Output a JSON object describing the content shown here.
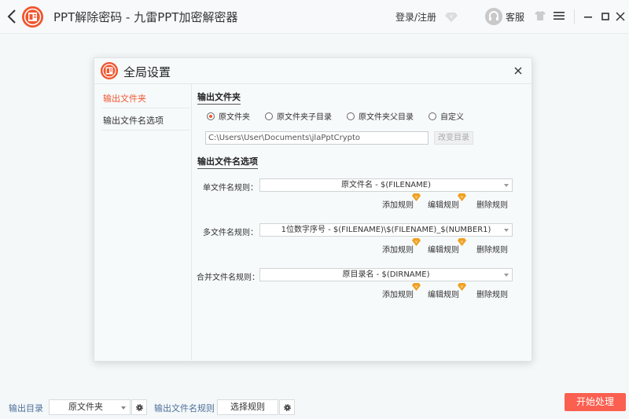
{
  "titlebar": {
    "title": "PPT解除密码 - 九雷PPT加密解密器",
    "login_label": "登录/注册",
    "service_label": "客服",
    "icons": [
      "back-icon",
      "app-logo-icon",
      "vip-icon",
      "headset-icon",
      "skin-icon",
      "menu-icon",
      "minimize-icon",
      "maximize-icon",
      "close-icon"
    ]
  },
  "dialog": {
    "title": "全局设置",
    "sidebar": [
      {
        "label": "输出文件夹",
        "active": true
      },
      {
        "label": "输出文件名选项",
        "active": false
      }
    ],
    "output_folder": {
      "section_title": "输出文件夹",
      "options": [
        {
          "label": "原文件夹",
          "selected": true
        },
        {
          "label": "原文件夹子目录",
          "selected": false
        },
        {
          "label": "原文件夹父目录",
          "selected": false
        },
        {
          "label": "自定义",
          "selected": false
        }
      ],
      "path_value": "C:\\Users\\User\\Documents\\jlaPptCrypto",
      "change_button": "改变目录"
    },
    "filename_options": {
      "section_title": "输出文件名选项",
      "rules": [
        {
          "label": "单文件名规则：",
          "value": "原文件名 - $(FILENAME)"
        },
        {
          "label": "多文件名规则：",
          "value": "1位数字序号 - $(FILENAME)\\$(FILENAME)_$(NUMBER1)"
        },
        {
          "label": "合并文件名规则：",
          "value": "原目录名 - $(DIRNAME)"
        }
      ],
      "actions": {
        "add": "添加规则",
        "edit": "编辑规则",
        "delete": "删除规则"
      }
    }
  },
  "bottom": {
    "output_dir_label": "输出目录",
    "output_dir_value": "原文件夹",
    "filename_rule_label": "输出文件名规则",
    "select_rule_button": "选择规则",
    "start_button": "开始处理"
  },
  "colors": {
    "accent": "#f0562f",
    "start": "#fb5f50",
    "vip": "#f0a020",
    "link_label": "#4d6f9a"
  }
}
